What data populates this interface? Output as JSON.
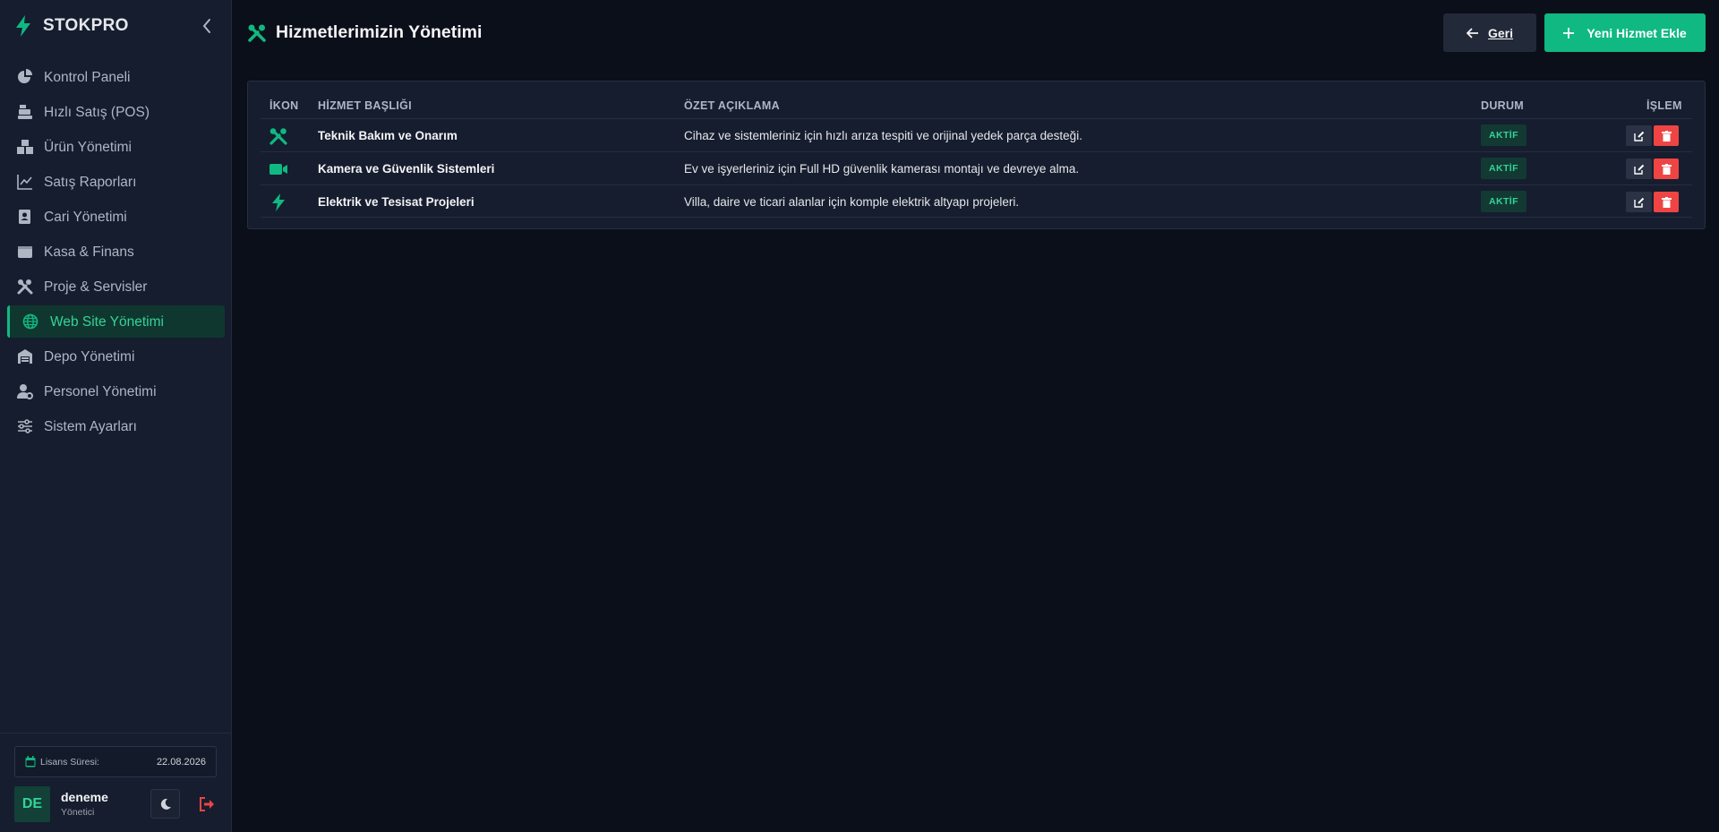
{
  "brand": {
    "name": "STOKPRO",
    "accent": "#10b981"
  },
  "sidebar": {
    "items": [
      {
        "label": "Kontrol Paneli",
        "icon": "pie-chart-icon"
      },
      {
        "label": "Hızlı Satış (POS)",
        "icon": "cash-register-icon"
      },
      {
        "label": "Ürün Yönetimi",
        "icon": "boxes-icon"
      },
      {
        "label": "Satış Raporları",
        "icon": "line-chart-icon"
      },
      {
        "label": "Cari Yönetimi",
        "icon": "address-book-icon"
      },
      {
        "label": "Kasa & Finans",
        "icon": "wallet-icon"
      },
      {
        "label": "Proje & Servisler",
        "icon": "tools-icon"
      },
      {
        "label": "Web Site Yönetimi",
        "icon": "globe-icon",
        "active": true
      },
      {
        "label": "Depo Yönetimi",
        "icon": "warehouse-icon"
      },
      {
        "label": "Personel Yönetimi",
        "icon": "user-gear-icon"
      },
      {
        "label": "Sistem Ayarları",
        "icon": "sliders-icon"
      }
    ]
  },
  "license": {
    "label": "Lisans Süresi:",
    "date": "22.08.2026"
  },
  "user": {
    "initials": "DE",
    "name": "deneme",
    "role": "Yönetici"
  },
  "header": {
    "title": "Hizmetlerimizin Yönetimi",
    "back_label": "Geri",
    "new_label": "Yeni Hizmet Ekle"
  },
  "table": {
    "columns": {
      "icon": "İKON",
      "title": "HİZMET BAŞLIĞI",
      "desc": "ÖZET AÇIKLAMA",
      "status": "DURUM",
      "action": "İŞLEM"
    },
    "rows": [
      {
        "icon": "tools-icon",
        "title": "Teknik Bakım ve Onarım",
        "desc": "Cihaz ve sistemleriniz için hızlı arıza tespiti ve orijinal yedek parça desteği.",
        "status": "AKTİF"
      },
      {
        "icon": "video-camera-icon",
        "title": "Kamera ve Güvenlik Sistemleri",
        "desc": "Ev ve işyerleriniz için Full HD güvenlik kamerası montajı ve devreye alma.",
        "status": "AKTİF"
      },
      {
        "icon": "bolt-icon",
        "title": "Elektrik ve Tesisat Projeleri",
        "desc": "Villa, daire ve ticari alanlar için komple elektrik altyapı projeleri.",
        "status": "AKTİF"
      }
    ]
  }
}
